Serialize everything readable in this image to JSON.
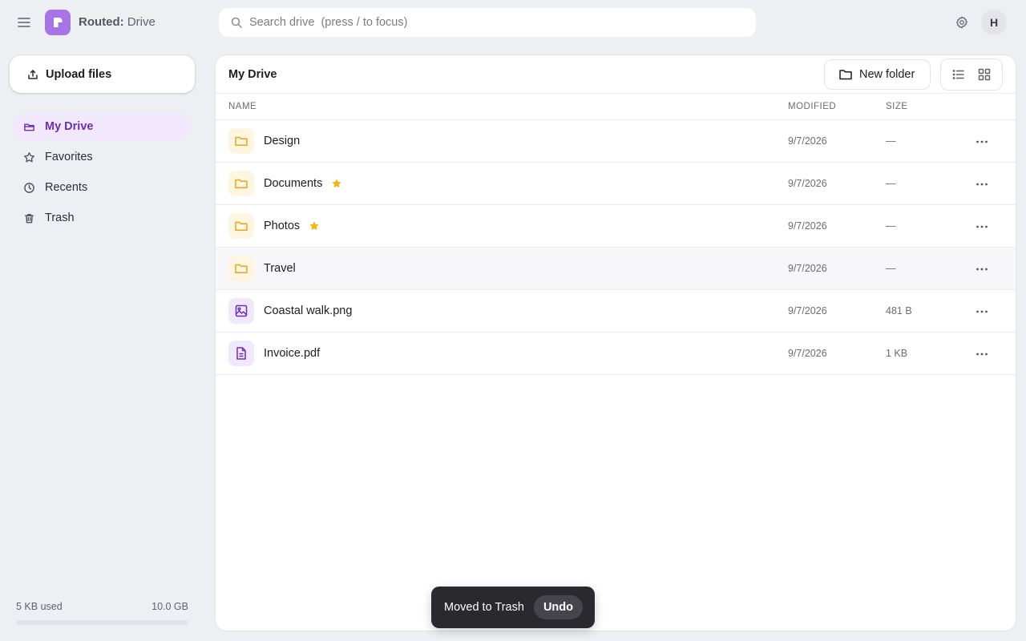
{
  "app": {
    "brand": "Routed:",
    "product": "Drive",
    "logo_letter": "r",
    "accent_color": "#a873e6"
  },
  "search": {
    "placeholder": "Search drive  (press / to focus)",
    "value": ""
  },
  "user": {
    "initial": "H"
  },
  "sidebar": {
    "upload_label": "Upload files",
    "items": [
      {
        "label": "My Drive",
        "icon": "folder-icon",
        "active": true
      },
      {
        "label": "Favorites",
        "icon": "star-icon",
        "active": false
      },
      {
        "label": "Recents",
        "icon": "clock-icon",
        "active": false
      },
      {
        "label": "Trash",
        "icon": "trash-icon",
        "active": false
      }
    ],
    "storage": {
      "used": "5 KB used",
      "total": "10.0 GB",
      "fraction_used": 0.0
    }
  },
  "main": {
    "title": "My Drive",
    "new_folder_label": "New folder",
    "columns": {
      "name": "NAME",
      "modified": "MODIFIED",
      "size": "SIZE"
    },
    "files": [
      {
        "name": "Design",
        "type": "folder",
        "starred": false,
        "modified": "9/7/2026",
        "size": "—"
      },
      {
        "name": "Documents",
        "type": "folder",
        "starred": true,
        "modified": "9/7/2026",
        "size": "—"
      },
      {
        "name": "Photos",
        "type": "folder",
        "starred": true,
        "modified": "9/7/2026",
        "size": "—"
      },
      {
        "name": "Travel",
        "type": "folder",
        "starred": false,
        "modified": "9/7/2026",
        "size": "—"
      },
      {
        "name": "Coastal walk.png",
        "type": "image",
        "starred": false,
        "modified": "9/7/2026",
        "size": "481 B"
      },
      {
        "name": "Invoice.pdf",
        "type": "pdf",
        "starred": false,
        "modified": "9/7/2026",
        "size": "1 KB"
      }
    ]
  },
  "toast": {
    "message": "Moved to Trash",
    "action": "Undo"
  }
}
